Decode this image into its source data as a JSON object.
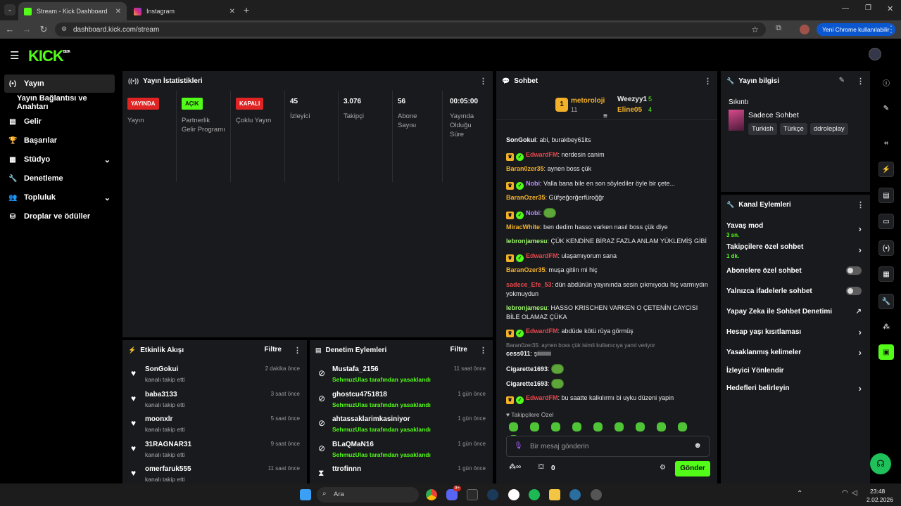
{
  "browser": {
    "tabs": [
      {
        "label": "Stream - Kick Dashboard",
        "active": true
      },
      {
        "label": "Instagram",
        "active": false
      }
    ],
    "url": "dashboard.kick.com/stream",
    "profile_button": "Yeni Chrome kullanılabilir"
  },
  "app": {
    "logo": "KICK",
    "logo_sup": "BETA"
  },
  "sidebar": {
    "items": [
      {
        "label": "Yayın",
        "icon": "broadcast-icon"
      },
      {
        "label": "Yayın Bağlantısı ve Anahtarı",
        "icon": ""
      },
      {
        "label": "Gelir",
        "icon": "chart-icon"
      },
      {
        "label": "Başarılar",
        "icon": "trophy-icon"
      },
      {
        "label": "Stüdyo",
        "icon": "layout-icon"
      },
      {
        "label": "Denetleme",
        "icon": "wrench-icon"
      },
      {
        "label": "Topluluk",
        "icon": "users-icon"
      },
      {
        "label": "Droplar ve ödüller",
        "icon": "gift-icon"
      }
    ]
  },
  "stats": {
    "title": "Yayın İstatistikleri",
    "cols": [
      {
        "badge": "YAYINDA",
        "label": "Yayın"
      },
      {
        "badge": "AÇIK",
        "label": "Partnerlik Gelir Programı"
      },
      {
        "badge": "KAPALI",
        "label": "Çoklu Yayın"
      },
      {
        "value": "45",
        "label": "İzleyici"
      },
      {
        "value": "3.076",
        "label": "Takipçi"
      },
      {
        "value": "56",
        "label": "Abone Sayısı"
      },
      {
        "value": "00:05:00",
        "label": "Yayında Olduğu Süre"
      }
    ],
    "colors": {
      "live": "#e02424",
      "on": "#53fc18",
      "off": "#e02424"
    }
  },
  "activity": {
    "title": "Etkinlik Akışı",
    "filter": "Filtre",
    "rows": [
      {
        "name": "SonGokui",
        "sub": "kanalı takip etti",
        "time": "2 dakika önce"
      },
      {
        "name": "baba3133",
        "sub": "kanalı takip etti",
        "time": "3 saat önce"
      },
      {
        "name": "moonxlr",
        "sub": "kanalı takip etti",
        "time": "5 saat önce"
      },
      {
        "name": "31RAGNAR31",
        "sub": "kanalı takip etti",
        "time": "9 saat önce"
      },
      {
        "name": "omerfaruk555",
        "sub": "kanalı takip etti",
        "time": "11 saat önce"
      }
    ]
  },
  "moderation": {
    "title": "Denetim Eylemleri",
    "filter": "Filtre",
    "rows": [
      {
        "name": "Mustafa_2156",
        "sub": "SehmuzUlas tarafından yasaklandı",
        "time": "11 saat önce"
      },
      {
        "name": "ghostcu4751818",
        "sub": "SehmuzUlas tarafından yasaklandı",
        "time": "1 gün önce"
      },
      {
        "name": "ahtassaklarimkasiniyor",
        "sub": "SehmuzUlas tarafından yasaklandı",
        "time": "1 gün önce"
      },
      {
        "name": "BLaQMaN16",
        "sub": "SehmuzUlas tarafından yasaklandı",
        "time": "1 gün önce"
      },
      {
        "name": "ttrofinnn",
        "sub": "",
        "time": "1 gün önce"
      }
    ]
  },
  "chat": {
    "title": "Sohbet",
    "leaders": [
      {
        "name": "metoroloji",
        "count": "11",
        "rank": "1"
      },
      {
        "name": "Weezyy1",
        "count": "5"
      },
      {
        "name": "Eline05",
        "count": "4"
      }
    ],
    "messages": [
      {
        "user": "SonGokui",
        "color": "#f7f7f7",
        "text": "abi, burakbey61its",
        "badges": false
      },
      {
        "user": "EdwardFM",
        "color": "#e8474b",
        "text": "nerdesin canim",
        "badges": true
      },
      {
        "user": "Baran0zer35",
        "color": "#f3b12a",
        "text": "aynen boss çük",
        "badges": false
      },
      {
        "user": "Nobi",
        "color": "#b48cf0",
        "text": "Valla bana bile en son söylediler öyle bir çete...",
        "badges": true
      },
      {
        "user": "BaranOzer35",
        "color": "#f3b12a",
        "text": "Güfşeğorğerfüroğğr",
        "badges": false
      },
      {
        "user": "Nobi",
        "color": "#b48cf0",
        "text": "",
        "badges": true,
        "emote": true
      },
      {
        "user": "MiracWhite",
        "color": "#f3b12a",
        "text": "ben dedim hasso varken nasıl boss çük diye",
        "badges": false
      },
      {
        "user": "lebronjamesu",
        "color": "#9ef56a",
        "text": "ÇÜK KENDİNE BİRAZ FAZLA ANLAM YÜKLEMİŞ GİBİ",
        "badges": false
      },
      {
        "user": "EdwardFM",
        "color": "#e8474b",
        "text": "ulaşamıyorum sana",
        "badges": true
      },
      {
        "user": "BaranOzer35",
        "color": "#f3b12a",
        "text": "muşa gitiin mi hiç",
        "badges": false
      },
      {
        "user": "sadece_Efe_53",
        "color": "#e8474b",
        "text": "dün abdünün yayınında sesin çıkmıyodu hiç varmıydın yokmuydun",
        "badges": false
      },
      {
        "user": "lebronjamesu",
        "color": "#9ef56a",
        "text": "HASSO KRISCHEN VARKEN O ÇETENİN CAYCISI BİLE OLAMAZ ÇÜKA",
        "badges": false
      },
      {
        "user": "EdwardFM",
        "color": "#e8474b",
        "text": "abdüde kötü rüya görmüş",
        "badges": true
      },
      {
        "user": "cess011",
        "color": "#f7f7f7",
        "text": "şiiiiiiiiii",
        "badges": false,
        "reply": "Baran0zer35: aynen boss çük isimli kullanıcıya yanıt veriyor"
      },
      {
        "user": "Cigarette1693",
        "color": "#f7f7f7",
        "text": "",
        "badges": false,
        "emote": true
      },
      {
        "user": "Cigarette1693",
        "color": "#f7f7f7",
        "text": "",
        "badges": false,
        "emote": true
      },
      {
        "user": "EdwardFM",
        "color": "#e8474b",
        "text": "bu saatte kalkılırmı bi uyku düzeni yapin",
        "badges": true
      }
    ],
    "followers_only": "Takipçilere Özel",
    "input_placeholder": "Bir mesaj gönderin",
    "points": "0",
    "send": "Gönder"
  },
  "stream_info": {
    "title": "Yayın bilgisi",
    "section": "Sıkıntı",
    "category": "Sadece Sohbet",
    "tags": [
      "Turkish",
      "Türkçe",
      "ddroleplay"
    ]
  },
  "channel_actions": {
    "title": "Kanal Eylemleri",
    "items": [
      {
        "label": "Yavaş mod",
        "sub": "3 sn.",
        "control": "arrow"
      },
      {
        "label": "Takipçilere özel sohbet",
        "sub": "1 dk.",
        "control": "arrow"
      },
      {
        "label": "Abonelere özel sohbet",
        "control": "toggle"
      },
      {
        "label": "Yalnızca ifadelerle sohbet",
        "control": "toggle"
      },
      {
        "label": "Yapay Zeka ile Sohbet Denetimi",
        "control": "external"
      },
      {
        "label": "Hesap yaşı kısıtlaması",
        "control": "arrow"
      },
      {
        "label": "Yasaklanmış kelimeler",
        "control": "arrow"
      },
      {
        "label": "İzleyici Yönlendir",
        "control": "none"
      },
      {
        "label": "Hedefleri belirleyin",
        "control": "arrow"
      }
    ]
  },
  "taskbar": {
    "search": "Ara",
    "time": "23:48",
    "date": "2.02.2026",
    "badge": "9+"
  }
}
